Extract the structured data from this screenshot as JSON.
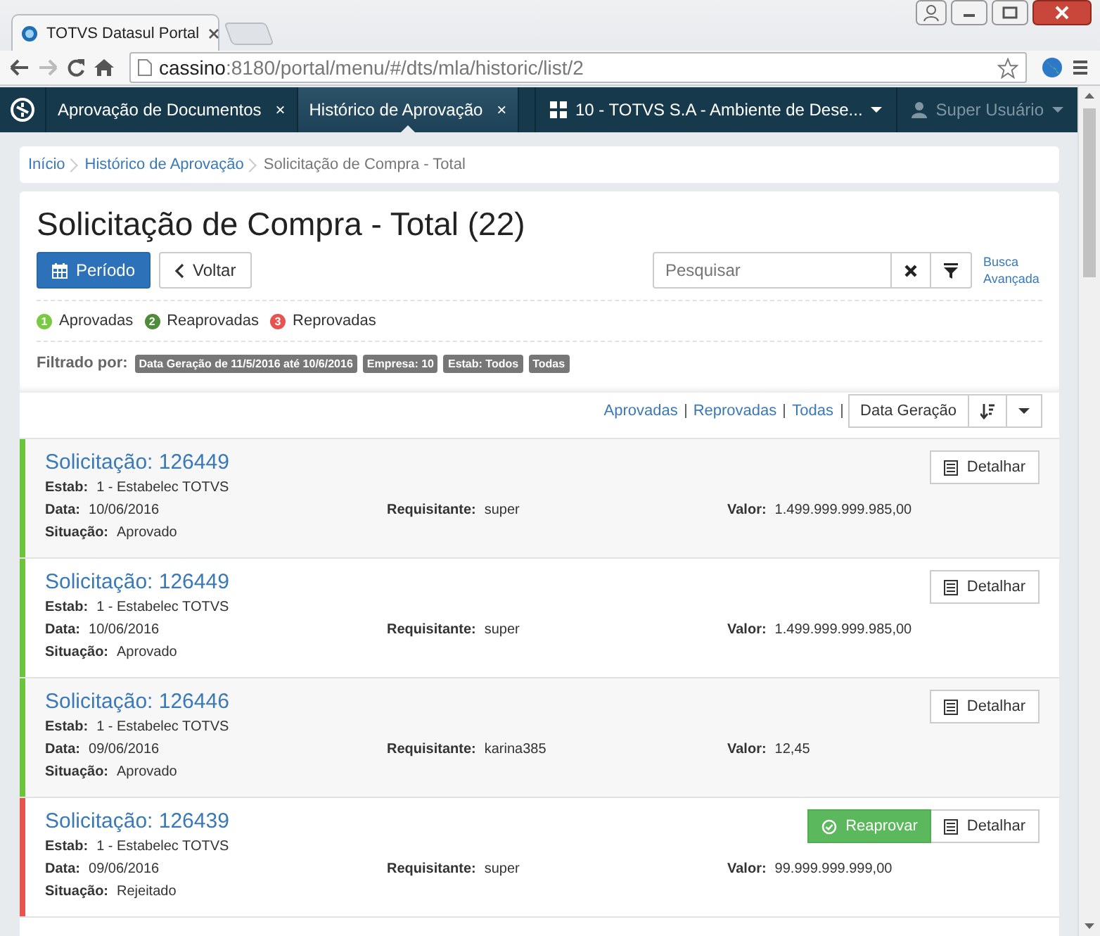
{
  "browser": {
    "tab_title": "TOTVS Datasul Portal",
    "url_host": "cassino",
    "url_rest": ":8180/portal/menu/#/dts/mla/historic/list/2"
  },
  "app_nav": {
    "tabs": [
      {
        "label": "Aprovação de Documentos",
        "close": "×",
        "selected": false
      },
      {
        "label": "Histórico de Aprovação",
        "close": "×",
        "selected": true
      }
    ],
    "company": "10 - TOTVS S.A - Ambiente de Dese...",
    "user": "Super Usuário"
  },
  "breadcrumb": [
    "Início",
    "Histórico de Aprovação",
    "Solicitação de Compra - Total"
  ],
  "header": {
    "title": "Solicitação de Compra - Total (22)",
    "period_button": "Período",
    "back_button": "Voltar",
    "search": {
      "placeholder": "Pesquisar"
    },
    "advanced_search": "Busca Avançada"
  },
  "legend": [
    {
      "number": "1",
      "label": "Aprovadas",
      "color": "#7ac943"
    },
    {
      "number": "2",
      "label": "Reaprovadas",
      "color": "#4e8b3a"
    },
    {
      "number": "3",
      "label": "Reprovadas",
      "color": "#e9534f"
    }
  ],
  "filter": {
    "label": "Filtrado por:",
    "tags": [
      "Data Geração de 11/5/2016 até 10/6/2016",
      "Empresa: 10",
      "Estab: Todos",
      "Todas"
    ]
  },
  "sort_bar": {
    "links": [
      "Aprovadas",
      "Reprovadas",
      "Todas"
    ],
    "sort_field": "Data Geração"
  },
  "requests": [
    {
      "title": "Solicitação: 126449",
      "color": "#6bc43a",
      "estab": {
        "label": "Estab:",
        "value": "1 - Estabelec TOTVS"
      },
      "date": {
        "label": "Data:",
        "value": "10/06/2016"
      },
      "requester": {
        "label": "Requisitante:",
        "value": "super"
      },
      "amount": {
        "label": "Valor:",
        "value": "1.499.999.999.985,00"
      },
      "status": {
        "label": "Situação:",
        "value": "Aprovado"
      },
      "actions": [
        {
          "kind": "detail",
          "label": "Detalhar"
        }
      ]
    },
    {
      "title": "Solicitação: 126449",
      "color": "#6bc43a",
      "estab": {
        "label": "Estab:",
        "value": "1 - Estabelec TOTVS"
      },
      "date": {
        "label": "Data:",
        "value": "10/06/2016"
      },
      "requester": {
        "label": "Requisitante:",
        "value": "super"
      },
      "amount": {
        "label": "Valor:",
        "value": "1.499.999.999.985,00"
      },
      "status": {
        "label": "Situação:",
        "value": "Aprovado"
      },
      "actions": [
        {
          "kind": "detail",
          "label": "Detalhar"
        }
      ]
    },
    {
      "title": "Solicitação: 126446",
      "color": "#6bc43a",
      "estab": {
        "label": "Estab:",
        "value": "1 - Estabelec TOTVS"
      },
      "date": {
        "label": "Data:",
        "value": "09/06/2016"
      },
      "requester": {
        "label": "Requisitante:",
        "value": "karina385"
      },
      "amount": {
        "label": "Valor:",
        "value": "12,45"
      },
      "status": {
        "label": "Situação:",
        "value": "Aprovado"
      },
      "actions": [
        {
          "kind": "detail",
          "label": "Detalhar"
        }
      ]
    },
    {
      "title": "Solicitação: 126439",
      "color": "#e9534f",
      "estab": {
        "label": "Estab:",
        "value": "1 - Estabelec TOTVS"
      },
      "date": {
        "label": "Data:",
        "value": "09/06/2016"
      },
      "requester": {
        "label": "Requisitante:",
        "value": "super"
      },
      "amount": {
        "label": "Valor:",
        "value": "99.999.999.999,00"
      },
      "status": {
        "label": "Situação:",
        "value": "Rejeitado"
      },
      "actions": [
        {
          "kind": "reapprove",
          "label": "Reaprovar"
        },
        {
          "kind": "detail",
          "label": "Detalhar"
        }
      ]
    }
  ]
}
